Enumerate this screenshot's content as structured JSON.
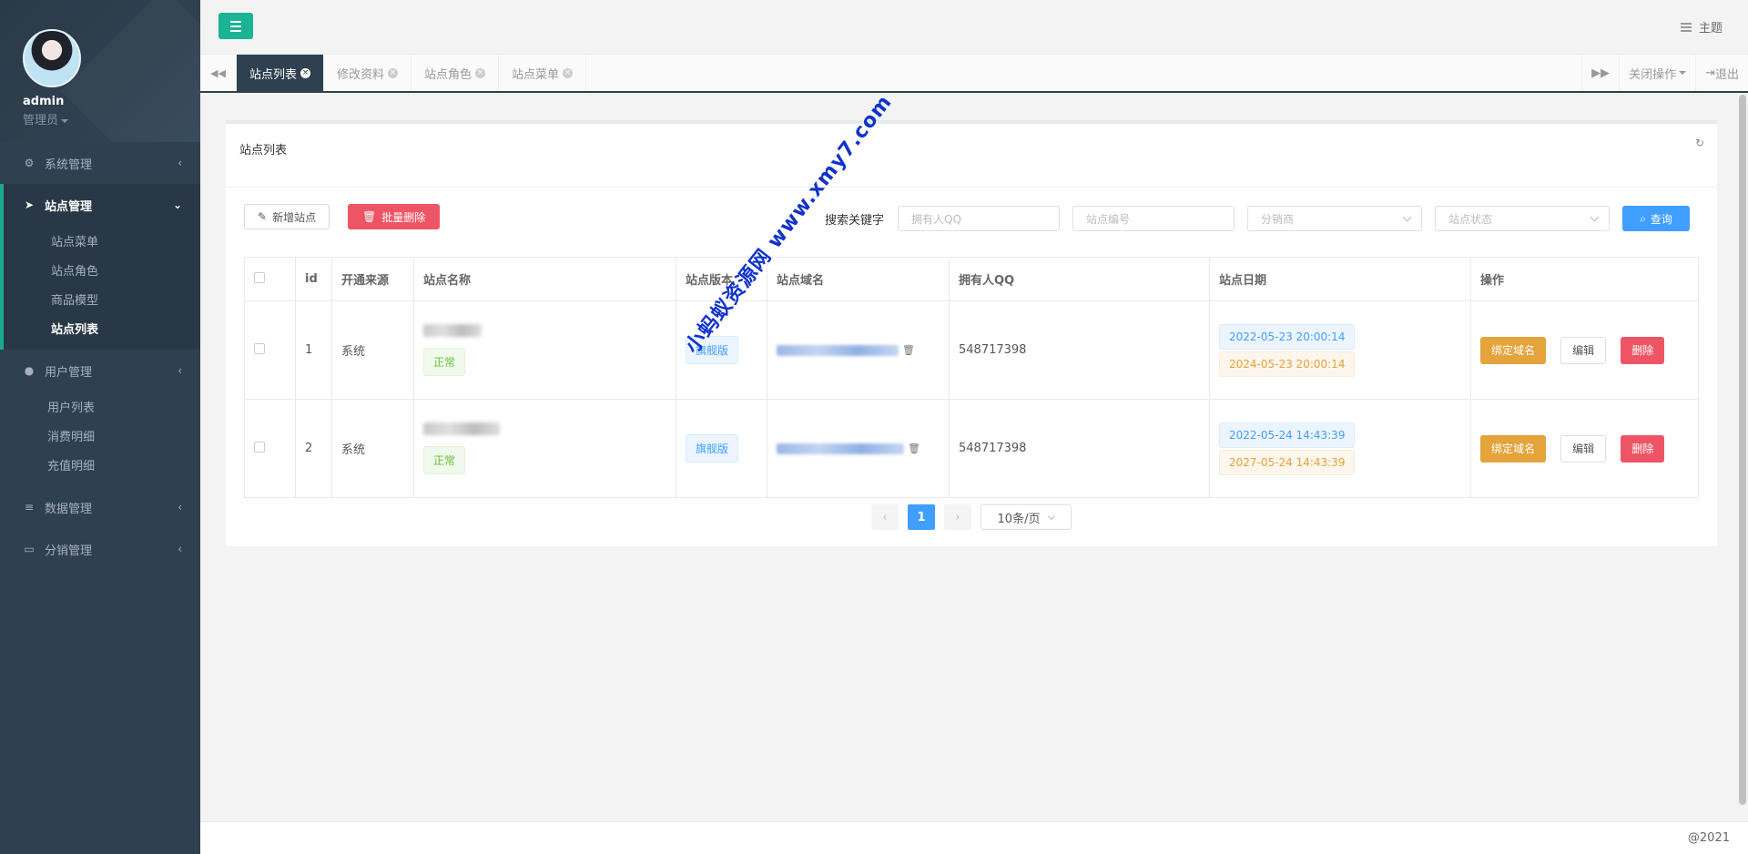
{
  "sidebar": {
    "user": {
      "name": "admin",
      "role": "管理员"
    },
    "menus": [
      {
        "label": "系统管理",
        "icon": "gears-icon"
      },
      {
        "label": "站点管理",
        "icon": "paper-plane-icon",
        "items": [
          "站点菜单",
          "站点角色",
          "商品模型",
          "站点列表"
        ]
      },
      {
        "label": "用户管理",
        "icon": "user-icon",
        "items": [
          "用户列表",
          "消费明细",
          "充值明细"
        ]
      },
      {
        "label": "数据管理",
        "icon": "database-icon"
      },
      {
        "label": "分销管理",
        "icon": "desktop-icon"
      }
    ]
  },
  "header": {
    "theme_label": "主题"
  },
  "tabs": {
    "items": [
      "站点列表",
      "修改资料",
      "站点角色",
      "站点菜单"
    ],
    "close_ops": "关闭操作",
    "logout": "退出"
  },
  "panel": {
    "title": "站点列表",
    "toolbar": {
      "add_label": "新增站点",
      "batch_delete_label": "批量删除",
      "search_label": "搜索关键字",
      "owner_qq_placeholder": "拥有人QQ",
      "site_no_placeholder": "站点编号",
      "distributor_placeholder": "分销商",
      "status_placeholder": "站点状态",
      "query_label": "查询"
    },
    "table": {
      "headers": [
        "id",
        "开通来源",
        "站点名称",
        "站点版本",
        "站点域名",
        "拥有人QQ",
        "站点日期",
        "操作"
      ],
      "rows": [
        {
          "id": "1",
          "source": "系统",
          "status": "正常",
          "version": "旗舰版",
          "owner_qq": "548717398",
          "start_date": "2022-05-23 20:00:14",
          "end_date": "2024-05-23 20:00:14"
        },
        {
          "id": "2",
          "source": "系统",
          "status": "正常",
          "version": "旗舰版",
          "owner_qq": "548717398",
          "start_date": "2022-05-24 14:43:39",
          "end_date": "2027-05-24 14:43:39"
        }
      ],
      "actions": {
        "bind": "绑定域名",
        "edit": "编辑",
        "delete": "删除"
      }
    },
    "pagination": {
      "current": "1",
      "page_size": "10条/页"
    }
  },
  "watermark": "小蚂蚁资源网 www.xmy7.com",
  "footer": {
    "copyright": "@2021"
  },
  "colors": {
    "sidebar": "#2f4050",
    "accent": "#1ab394",
    "danger": "#ed5565",
    "primary": "#409eff",
    "warning": "#e4a33b"
  }
}
